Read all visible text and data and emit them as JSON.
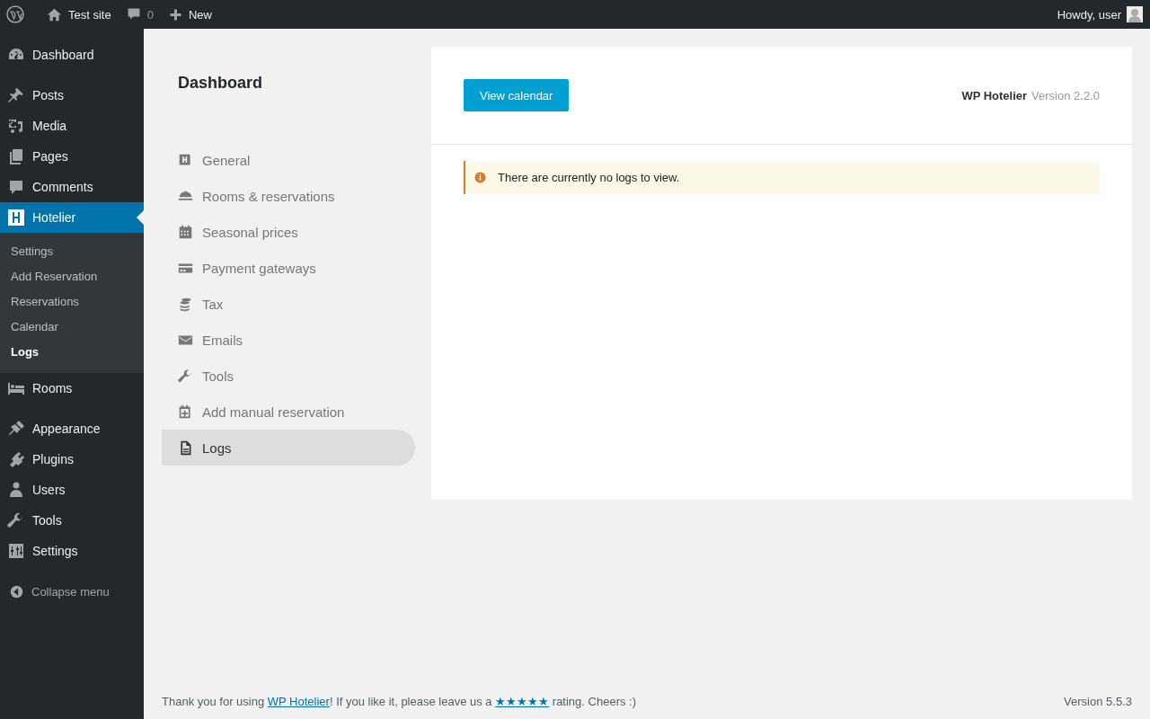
{
  "admin_bar": {
    "site_name": "Test site",
    "comments_count": "0",
    "new_label": "New",
    "greeting": "Howdy, user"
  },
  "sidebar": {
    "groups": [
      {
        "items": [
          {
            "label": "Dashboard",
            "selected": false
          }
        ]
      },
      {
        "items": [
          {
            "label": "Posts",
            "selected": false
          },
          {
            "label": "Media",
            "selected": false
          },
          {
            "label": "Pages",
            "selected": false
          },
          {
            "label": "Comments",
            "selected": false
          },
          {
            "label": "Hotelier",
            "selected": true,
            "children": [
              {
                "label": "Settings",
                "selected": false
              },
              {
                "label": "Add Reservation",
                "selected": false
              },
              {
                "label": "Reservations",
                "selected": false
              },
              {
                "label": "Calendar",
                "selected": false
              },
              {
                "label": "Logs",
                "selected": true
              }
            ]
          },
          {
            "label": "Rooms",
            "selected": false
          }
        ]
      },
      {
        "items": [
          {
            "label": "Appearance",
            "selected": false
          },
          {
            "label": "Plugins",
            "selected": false
          },
          {
            "label": "Users",
            "selected": false
          },
          {
            "label": "Tools",
            "selected": false
          },
          {
            "label": "Settings",
            "selected": false
          }
        ]
      }
    ],
    "collapse_label": "Collapse menu"
  },
  "page": {
    "title": "Dashboard",
    "nav": [
      {
        "label": "General",
        "selected": false
      },
      {
        "label": "Rooms & reservations",
        "selected": false
      },
      {
        "label": "Seasonal prices",
        "selected": false
      },
      {
        "label": "Payment gateways",
        "selected": false
      },
      {
        "label": "Tax",
        "selected": false
      },
      {
        "label": "Emails",
        "selected": false
      },
      {
        "label": "Tools",
        "selected": false
      },
      {
        "label": "Add manual reservation",
        "selected": false
      },
      {
        "label": "Logs",
        "selected": true
      }
    ],
    "button": "View calendar",
    "plugin_name": "WP Hotelier",
    "plugin_version": "Version 2.2.0",
    "notice": "There are currently no logs to view."
  },
  "footer": {
    "text_before": "Thank you for using ",
    "link": "WP Hotelier",
    "text_middle": "! If you like it, please leave us a ",
    "rating_link": "★★★★★",
    "text_after": " rating. Cheers :)",
    "version": "Version 5.5.3"
  }
}
